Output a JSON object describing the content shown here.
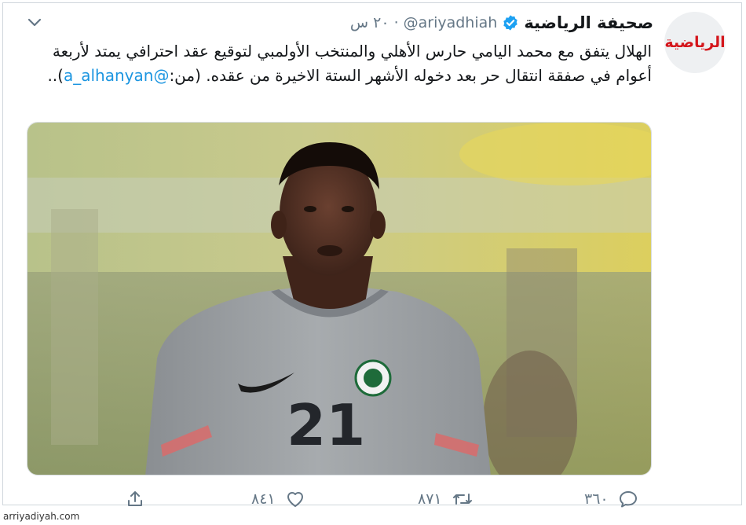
{
  "tweet": {
    "account_name": "صحيفة الرياضية",
    "handle": "@ariyadhiah",
    "separator": "·",
    "time": "٢٠ س",
    "avatar_text": "الرياضية",
    "text_main": "الهلال يتفق مع محمد اليامي حارس الأهلي والمنتخب الأولمبي لتوقيع عقد احترافي يمتد لأربعة أعوام في صفقة انتقال حر بعد دخوله الأشهر الستة الاخيرة من عقده. (من:",
    "mention": "@a_alhanyan",
    "text_end": ")..",
    "photo_jersey_number": "21"
  },
  "actions": {
    "reply_count": "٣٦٠",
    "retweet_count": "٨٧١",
    "like_count": "٨٤١"
  },
  "watermark": "arriyadiyah.com",
  "colors": {
    "link": "#1b95e0",
    "secondary_text": "#657786",
    "verified": "#1da1f2",
    "brand_red": "#d4161c"
  },
  "icons": [
    "verified-badge-icon",
    "chevron-down-icon",
    "reply-icon",
    "retweet-icon",
    "like-icon",
    "share-icon"
  ]
}
